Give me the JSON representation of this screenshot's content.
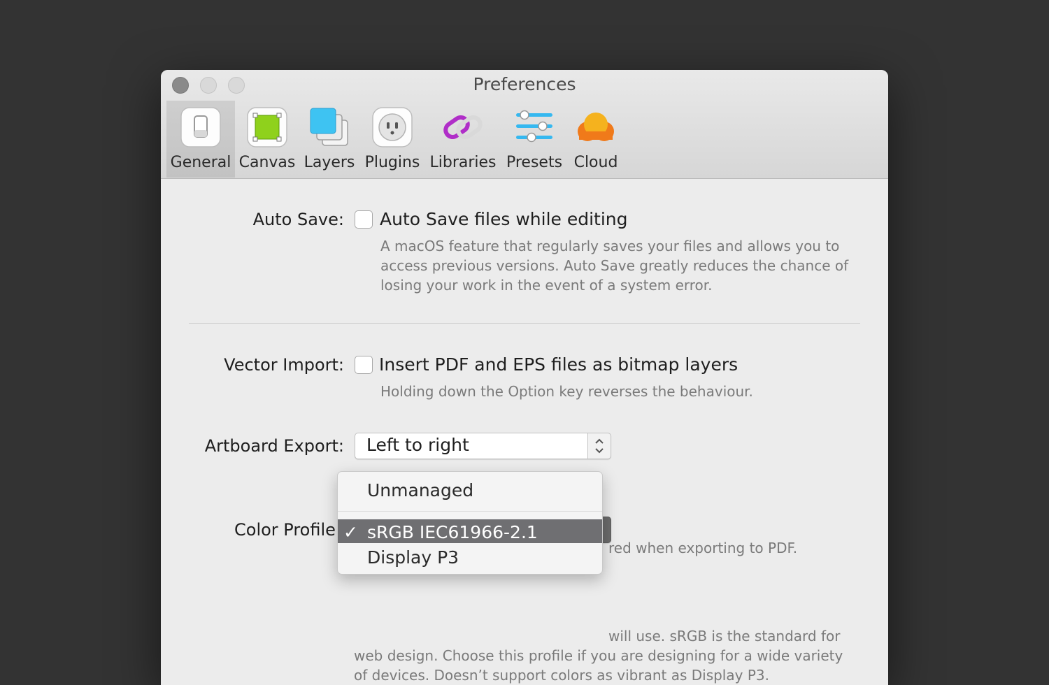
{
  "window": {
    "title": "Preferences"
  },
  "toolbar": {
    "tabs": [
      {
        "id": "general",
        "label": "General",
        "selected": true
      },
      {
        "id": "canvas",
        "label": "Canvas",
        "selected": false
      },
      {
        "id": "layers",
        "label": "Layers",
        "selected": false
      },
      {
        "id": "plugins",
        "label": "Plugins",
        "selected": false
      },
      {
        "id": "libraries",
        "label": "Libraries",
        "selected": false
      },
      {
        "id": "presets",
        "label": "Presets",
        "selected": false
      },
      {
        "id": "cloud",
        "label": "Cloud",
        "selected": false
      }
    ]
  },
  "auto_save": {
    "label": "Auto Save:",
    "checkbox_label": "Auto Save files while editing",
    "checked": false,
    "help": "A macOS feature that regularly saves your files and allows you to access previous versions. Auto Save greatly reduces the chance of losing your work in the event of a system error."
  },
  "vector_import": {
    "label": "Vector Import:",
    "checkbox_label": "Insert PDF and EPS files as bitmap layers",
    "checked": false,
    "help": "Holding down the Option key reverses the behaviour."
  },
  "artboard_export": {
    "label": "Artboard Export:",
    "value": "Left to right",
    "help_visible": "red when exporting to PDF."
  },
  "color_profile": {
    "label": "Color Profile",
    "help_visible_line1": "will use. sRGB is the standard for",
    "help_rest": "web design. Choose this profile if you are designing for a wide variety of devices. Doesn’t support colors as vibrant as Display P3.",
    "menu": {
      "items": [
        {
          "label": "Unmanaged",
          "checked": false
        },
        {
          "label": "sRGB IEC61966-2.1",
          "checked": true
        },
        {
          "label": "Display P3",
          "checked": false
        }
      ],
      "check_glyph": "✓"
    }
  },
  "colors": {
    "background": "#333333",
    "window": "#ececec",
    "menu_highlight": "#6f6f72",
    "canvas_green": "#8fd11c",
    "layers_blue": "#3ec3f2",
    "libraries_purple": "#b02ec8",
    "presets_blue": "#35b8f0",
    "cloud_orange": "#f5a01e"
  }
}
